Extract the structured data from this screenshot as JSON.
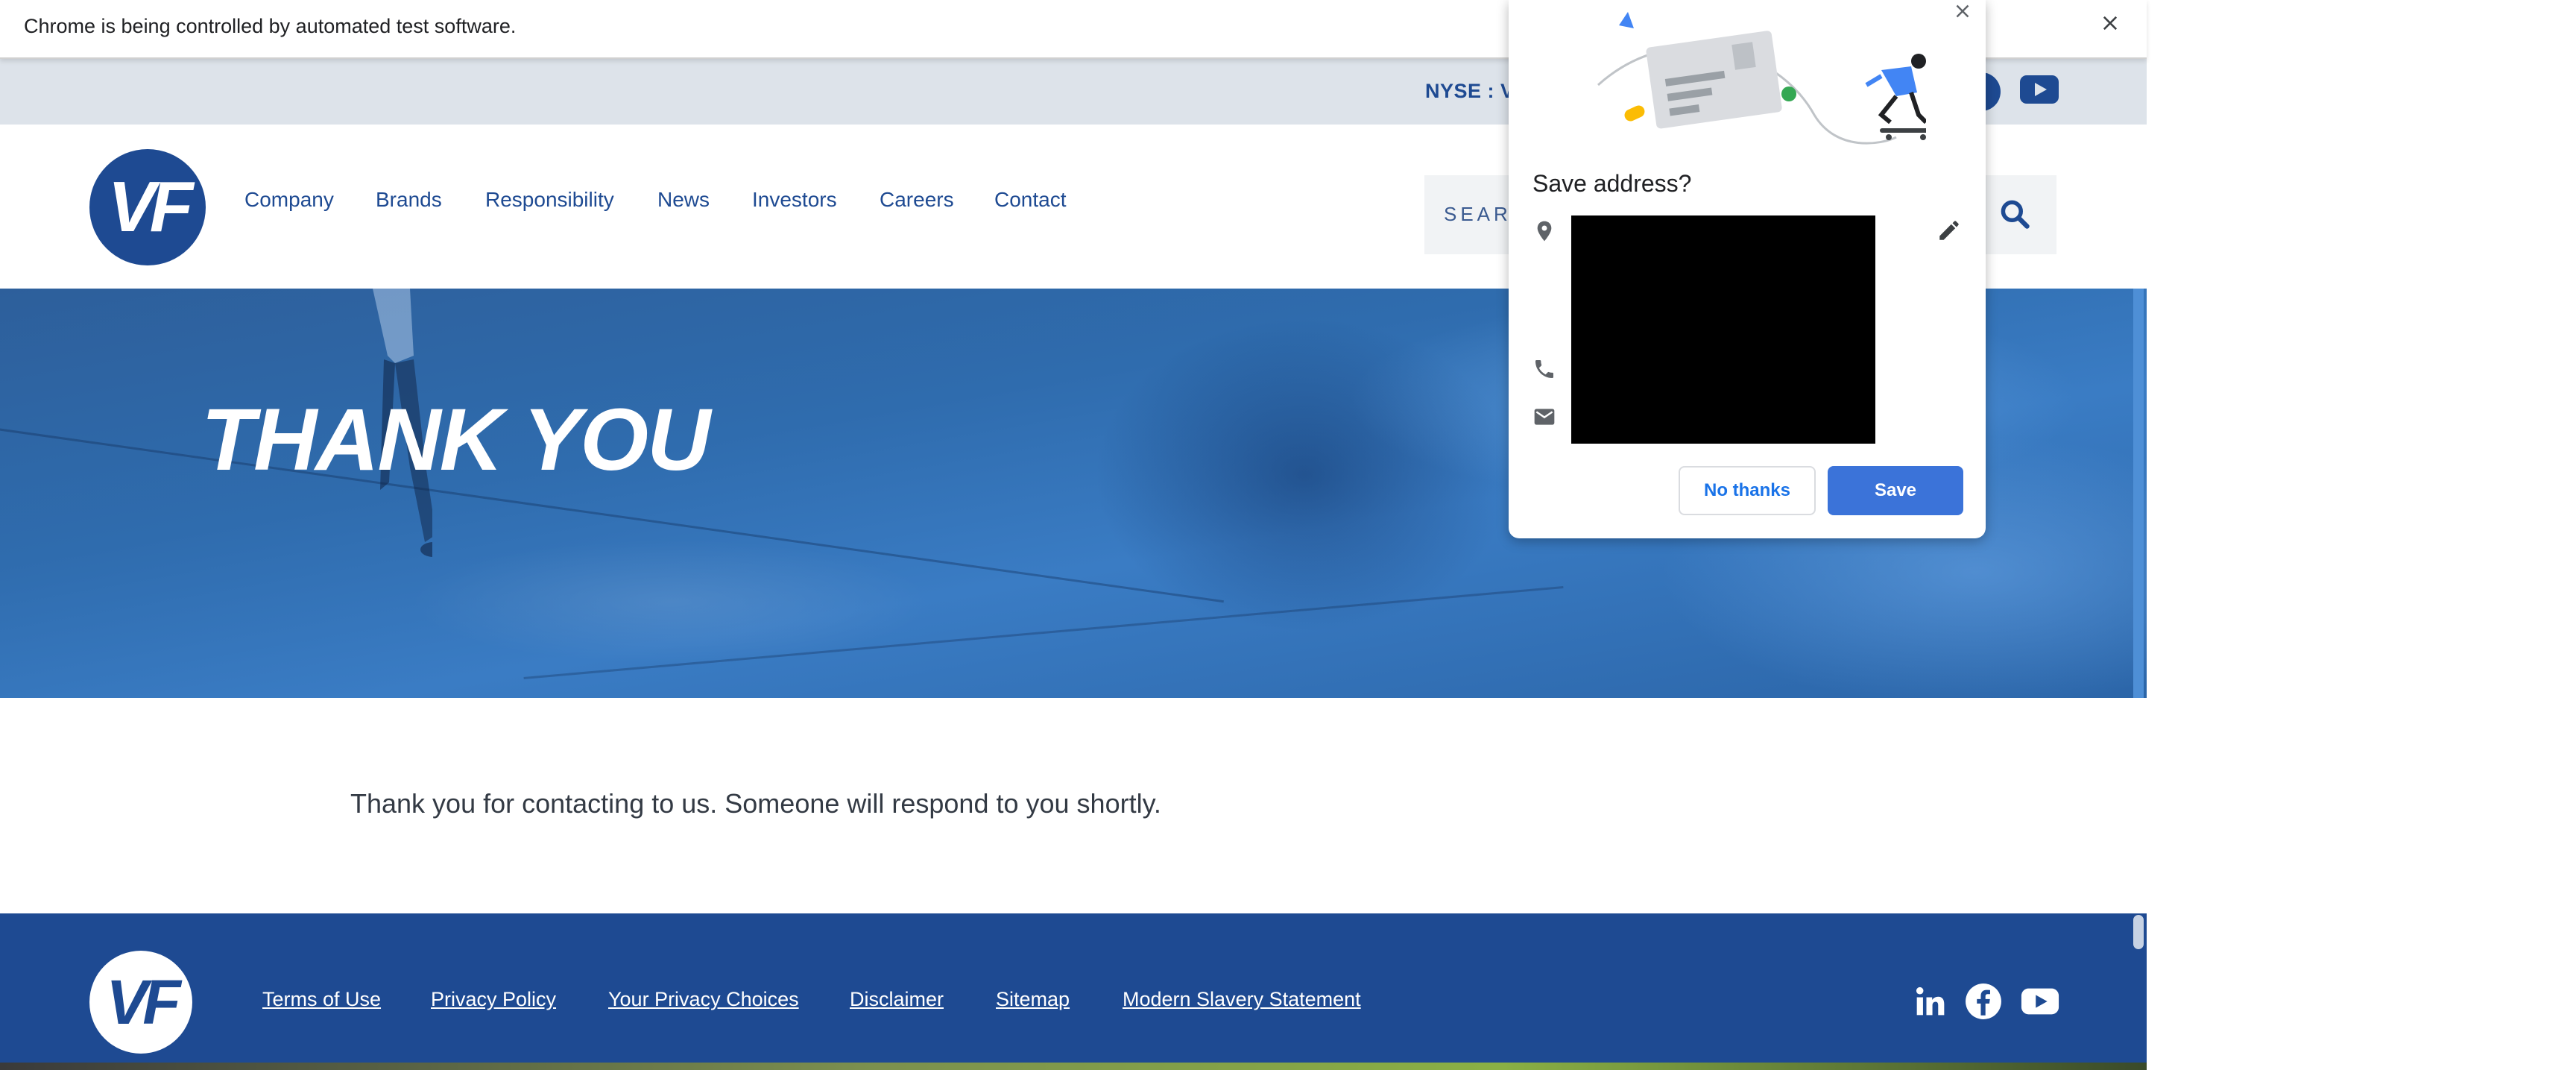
{
  "infobar": {
    "message": "Chrome is being controlled by automated test software."
  },
  "topbar": {
    "ticker": "NYSE : VF"
  },
  "header": {
    "logo": "VF",
    "nav": [
      "Company",
      "Brands",
      "Responsibility",
      "News",
      "Investors",
      "Careers",
      "Contact"
    ],
    "search_placeholder": "SEARCH"
  },
  "hero": {
    "title": "THANK YOU"
  },
  "main": {
    "message": "Thank you for contacting to us. Someone will respond to you shortly."
  },
  "footer": {
    "logo": "VF",
    "links": [
      "Terms of Use",
      "Privacy Policy",
      "Your Privacy Choices",
      "Disclaimer",
      "Sitemap",
      "Modern Slavery Statement"
    ]
  },
  "popup": {
    "title": "Save address?",
    "no_thanks_label": "No thanks",
    "save_label": "Save"
  },
  "colors": {
    "brand": "#1e4a92",
    "popup_primary": "#3b73d9",
    "hero": "#2f6cae"
  }
}
